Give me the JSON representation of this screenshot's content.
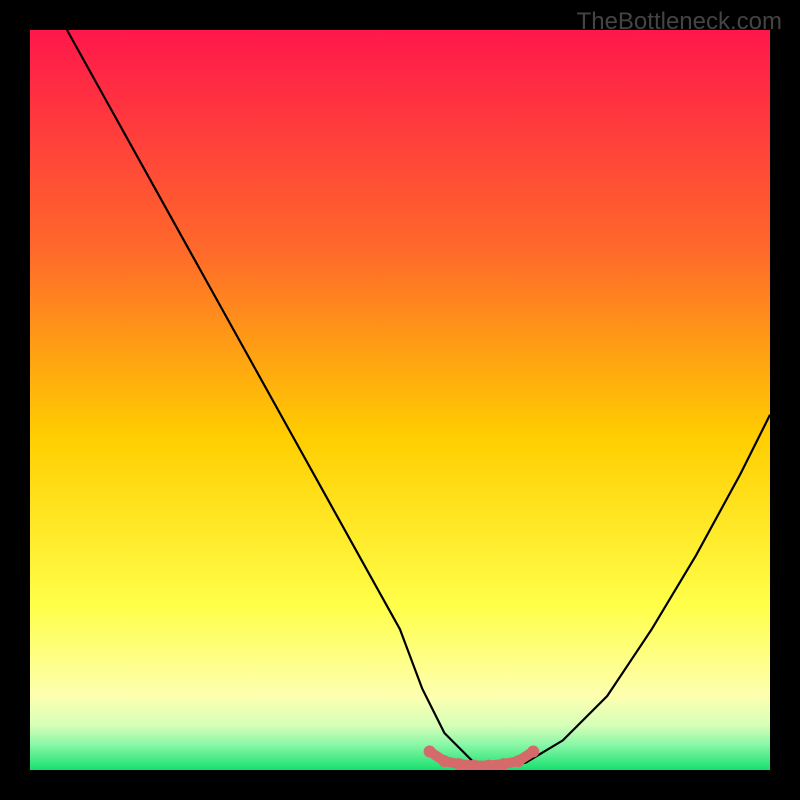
{
  "watermark": "TheBottleneck.com",
  "chart_data": {
    "type": "line",
    "title": "",
    "xlabel": "",
    "ylabel": "",
    "xlim": [
      0,
      100
    ],
    "ylim": [
      0,
      100
    ],
    "background_gradient": {
      "description": "vertical gradient representing bottleneck severity",
      "stops": [
        {
          "pos": 0.0,
          "color": "#ff174b",
          "meaning": "severe"
        },
        {
          "pos": 0.3,
          "color": "#ff6a2a",
          "meaning": "high"
        },
        {
          "pos": 0.55,
          "color": "#ffce00",
          "meaning": "medium"
        },
        {
          "pos": 0.78,
          "color": "#ffff4a",
          "meaning": "low"
        },
        {
          "pos": 0.9,
          "color": "#fdffb0",
          "meaning": "very-low"
        },
        {
          "pos": 0.945,
          "color": "#d6ffb8",
          "meaning": "minimal"
        },
        {
          "pos": 0.965,
          "color": "#8cf7a8",
          "meaning": "near-zero"
        },
        {
          "pos": 1.0,
          "color": "#18e06e",
          "meaning": "none"
        }
      ]
    },
    "series": [
      {
        "name": "bottleneck-curve",
        "color": "#000000",
        "x": [
          5,
          10,
          15,
          20,
          25,
          30,
          35,
          40,
          45,
          50,
          53,
          56,
          60,
          64,
          67,
          72,
          78,
          84,
          90,
          96,
          100
        ],
        "values": [
          100,
          91,
          82,
          73,
          64,
          55,
          46,
          37,
          28,
          19,
          11,
          5,
          1,
          0.5,
          1,
          4,
          10,
          19,
          29,
          40,
          48
        ]
      },
      {
        "name": "optimal-band-marker",
        "color": "#d46a6a",
        "x": [
          54,
          56,
          58,
          60,
          62,
          64,
          66,
          68
        ],
        "values": [
          2.5,
          1.2,
          0.8,
          0.6,
          0.6,
          0.8,
          1.2,
          2.5
        ]
      }
    ],
    "annotations": []
  }
}
